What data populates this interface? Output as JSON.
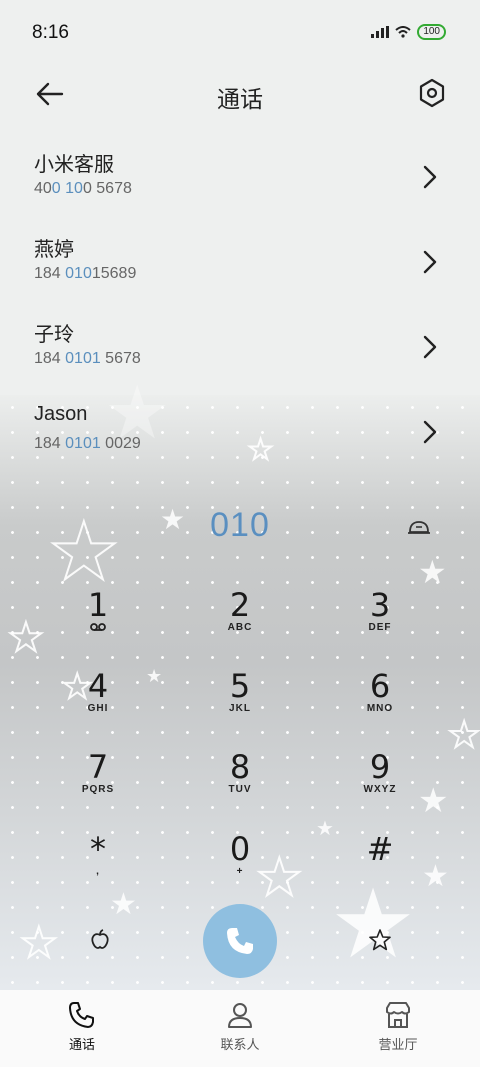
{
  "status_bar": {
    "time": "8:16",
    "battery": "100"
  },
  "header": {
    "title": "通话"
  },
  "contacts": [
    {
      "name": "小米客服",
      "number_pre": "40",
      "number_hl": "0 10",
      "number_post": "0 5678"
    },
    {
      "name": "燕婷",
      "number_pre": "184 ",
      "number_hl": "010",
      "number_post": "15689"
    },
    {
      "name": "子玲",
      "number_pre": "184 ",
      "number_hl": "0101",
      "number_post": " 5678"
    },
    {
      "name": "Jason",
      "number_pre": "184 ",
      "number_hl": "0101",
      "number_post": " 0029"
    }
  ],
  "dialpad": {
    "digits": "010",
    "keys": [
      {
        "num": "1",
        "sub": ""
      },
      {
        "num": "2",
        "sub": "ABC"
      },
      {
        "num": "3",
        "sub": "DEF"
      },
      {
        "num": "4",
        "sub": "GHI"
      },
      {
        "num": "5",
        "sub": "JKL"
      },
      {
        "num": "6",
        "sub": "MNO"
      },
      {
        "num": "7",
        "sub": "PQRS"
      },
      {
        "num": "8",
        "sub": "TUV"
      },
      {
        "num": "9",
        "sub": "WXYZ"
      },
      {
        "num": "*",
        "sub": ","
      },
      {
        "num": "0",
        "sub": "+"
      },
      {
        "num": "#",
        "sub": ""
      }
    ]
  },
  "tabs": [
    {
      "label": "通话",
      "icon": "phone-icon",
      "active": true
    },
    {
      "label": "联系人",
      "icon": "person-icon",
      "active": false
    },
    {
      "label": "营业厅",
      "icon": "store-icon",
      "active": false
    }
  ],
  "colors": {
    "accent": "#5b8fbd",
    "call_button": "#8fbfe0"
  }
}
